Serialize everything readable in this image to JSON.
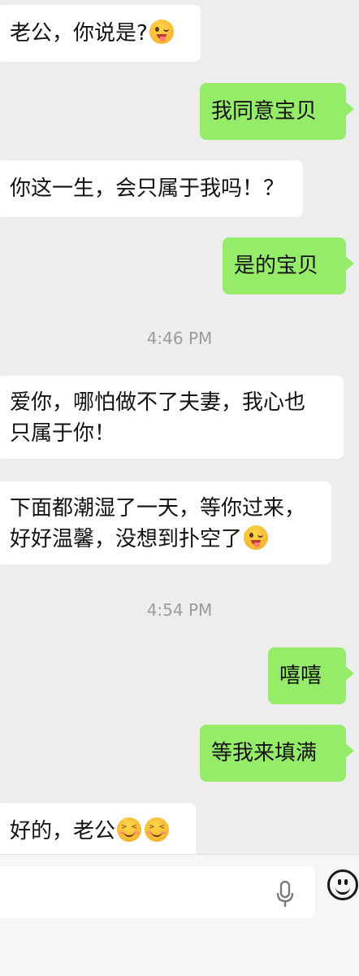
{
  "messages": [
    {
      "id": "m1",
      "side": "in",
      "text": "老公，你说是?",
      "emoji": "wink-tongue-emoji"
    },
    {
      "id": "m2",
      "side": "out",
      "text": "我同意宝贝"
    },
    {
      "id": "m3",
      "side": "in",
      "text": "你这一生，会只属于我吗！？"
    },
    {
      "id": "m4",
      "side": "out",
      "text": "是的宝贝"
    },
    {
      "id": "t1",
      "time": "4:46 PM"
    },
    {
      "id": "m5",
      "side": "in",
      "lines": [
        "爱你，哪怕做不了夫妻，我心也",
        "只属于你！"
      ]
    },
    {
      "id": "m6",
      "side": "in",
      "lines": [
        "下面都潮湿了一天，等你过来，",
        "好好温馨，没想到扑空了"
      ],
      "emoji": "wink-tongue-emoji"
    },
    {
      "id": "t2",
      "time": "4:54 PM"
    },
    {
      "id": "m7",
      "side": "out",
      "text": "嘻嘻"
    },
    {
      "id": "m8",
      "side": "out",
      "text": "等我来填满"
    },
    {
      "id": "m9",
      "side": "in",
      "text": "好的，老公",
      "emojis": [
        "blushing-squint-emoji",
        "blushing-squint-emoji"
      ]
    }
  ],
  "input_bar": {
    "text_field_value": "",
    "icons": [
      "microphone-icon",
      "emoji-icon"
    ]
  },
  "colors": {
    "background": "#ededed",
    "incoming": "#ffffff",
    "outgoing": "#95ec69",
    "timestamp": "#9b9b9b"
  }
}
